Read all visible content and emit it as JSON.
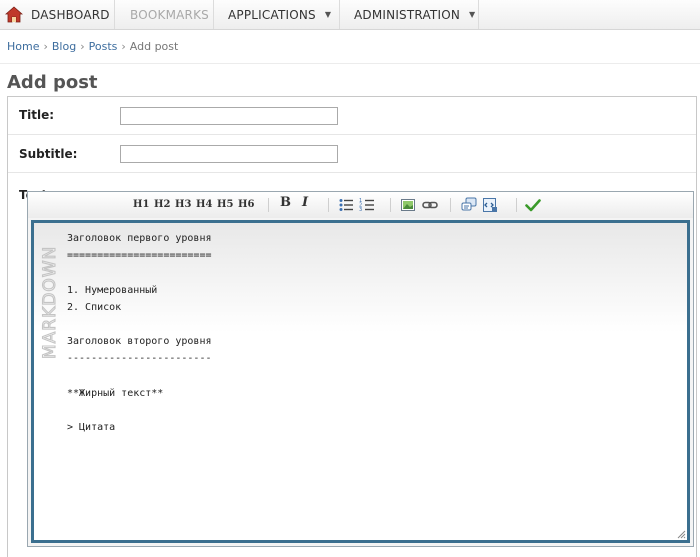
{
  "nav": {
    "dashboard": "DASHBOARD",
    "bookmarks": "BOOKMARKS",
    "applications": "APPLICATIONS",
    "administration": "ADMINISTRATION"
  },
  "breadcrumb": {
    "home": "Home",
    "blog": "Blog",
    "posts": "Posts",
    "current": "Add post",
    "separator": "›"
  },
  "page": {
    "title": "Add post"
  },
  "form": {
    "title_label": "Title:",
    "title_value": "",
    "subtitle_label": "Subtitle:",
    "subtitle_value": "",
    "text_label": "Text:"
  },
  "editor": {
    "toolbar": {
      "h1": "H1",
      "h2": "H2",
      "h3": "H3",
      "h4": "H4",
      "h5": "H5",
      "h6": "H6",
      "bold": "B",
      "italic": "I"
    },
    "stamp": "MARKDOWN",
    "content": "Заголовок первого уровня\n========================\n\n1. Нумерованный\n2. Список\n\nЗаголовок второго уровня\n------------------------\n\n**Жирный текст**\n\n> Цитата"
  },
  "colors": {
    "nav_bg": "#eeeeee",
    "link": "#3d6d9e",
    "editor_border": "#3b6f8f",
    "check": "#3a9a2a"
  }
}
